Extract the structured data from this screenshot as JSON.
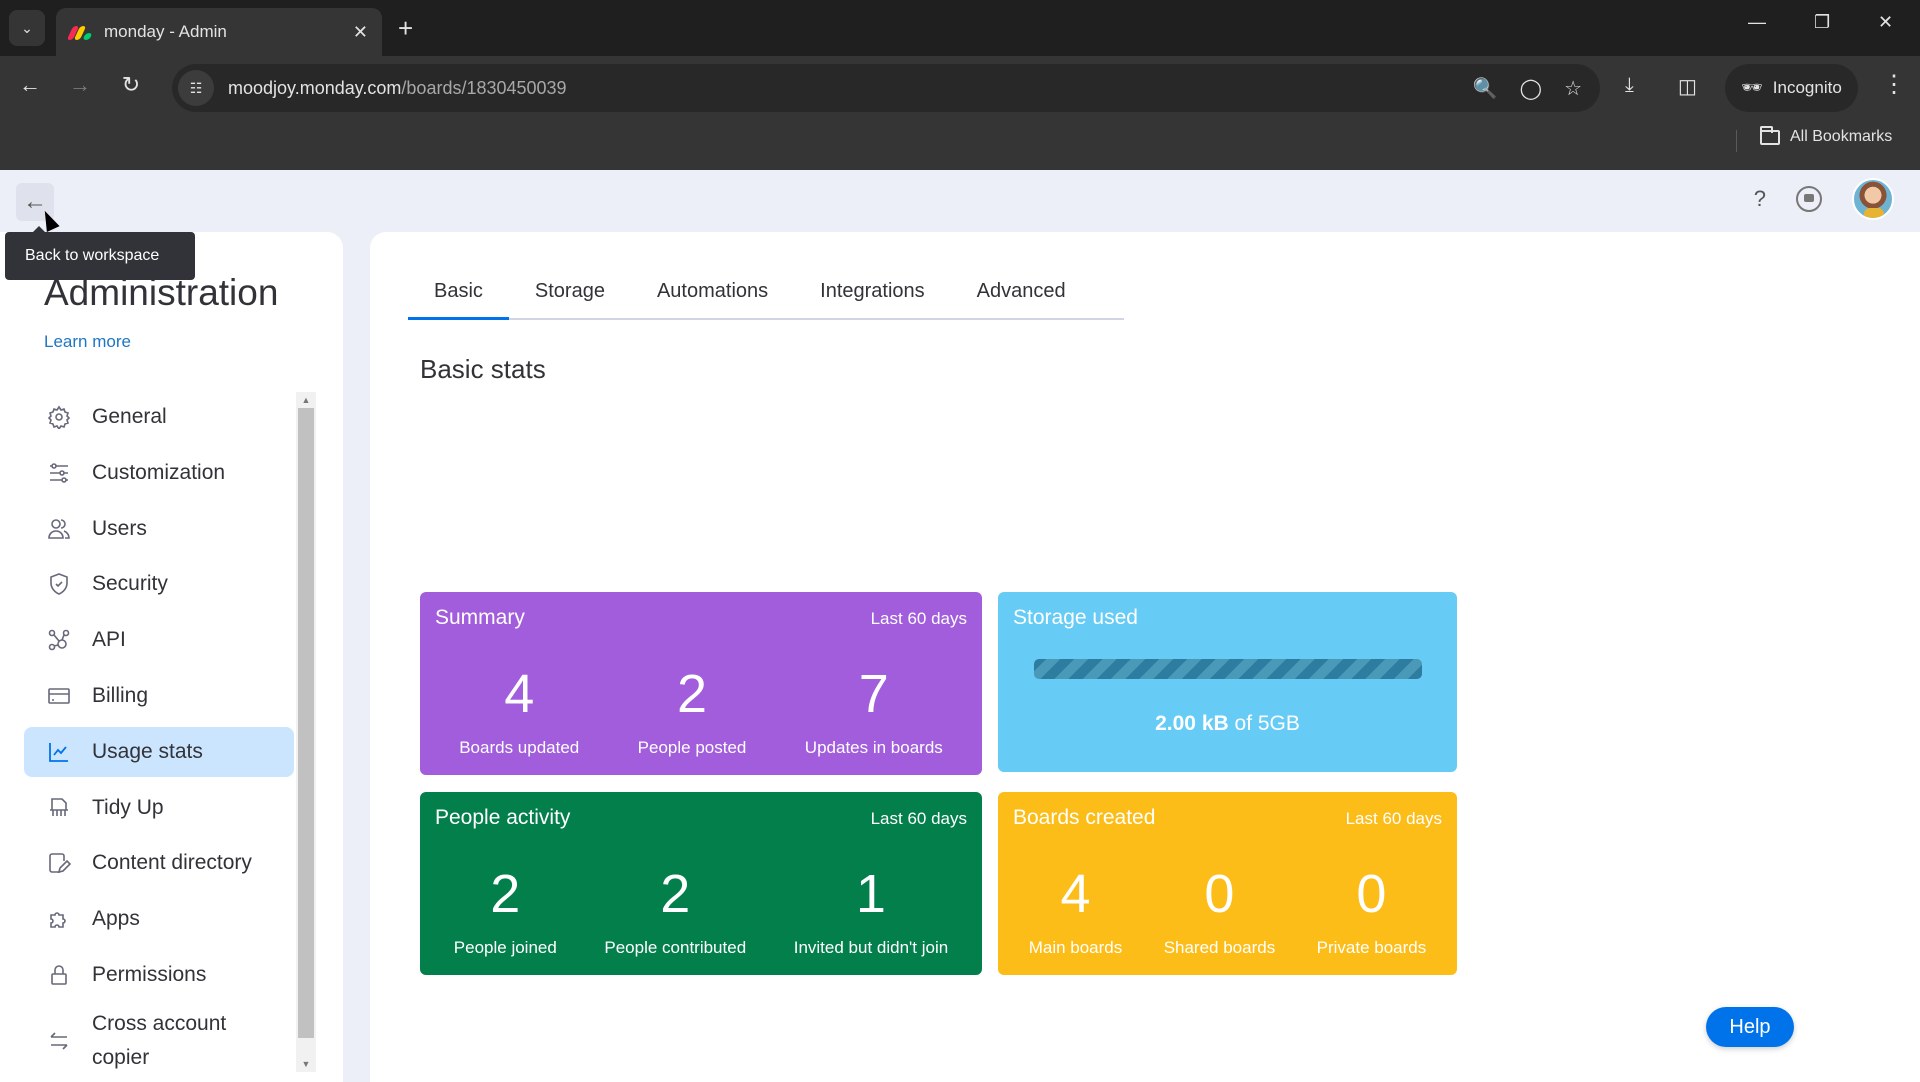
{
  "browser": {
    "tab_title": "monday - Admin",
    "url_host": "moodjoy.monday.com",
    "url_path": "/boards/1830450039",
    "incognito_label": "Incognito",
    "all_bookmarks_label": "All Bookmarks",
    "favicon_colors": [
      "#f62b54",
      "#ffcc00",
      "#00ca72"
    ]
  },
  "app": {
    "back_tooltip": "Back to workspace",
    "help_icon": "?",
    "help_button": "Help"
  },
  "sidebar": {
    "title": "Administration",
    "learn_more": "Learn more",
    "items": [
      {
        "label": "General",
        "icon": "gear-icon"
      },
      {
        "label": "Customization",
        "icon": "sliders-icon"
      },
      {
        "label": "Users",
        "icon": "users-icon"
      },
      {
        "label": "Security",
        "icon": "shield-icon"
      },
      {
        "label": "API",
        "icon": "api-icon"
      },
      {
        "label": "Billing",
        "icon": "credit-card-icon"
      },
      {
        "label": "Usage stats",
        "icon": "chart-icon",
        "active": true
      },
      {
        "label": "Tidy Up",
        "icon": "shredder-icon"
      },
      {
        "label": "Content directory",
        "icon": "content-directory-icon"
      },
      {
        "label": "Apps",
        "icon": "puzzle-icon"
      },
      {
        "label": "Permissions",
        "icon": "lock-icon"
      },
      {
        "label": "Cross account copier",
        "icon": "swap-icon"
      }
    ]
  },
  "main": {
    "tabs": [
      {
        "label": "Basic",
        "active": true
      },
      {
        "label": "Storage"
      },
      {
        "label": "Automations"
      },
      {
        "label": "Integrations"
      },
      {
        "label": "Advanced"
      }
    ],
    "section_title": "Basic stats",
    "cards": {
      "summary": {
        "title": "Summary",
        "period": "Last 60 days",
        "color": "#a25ddc",
        "stats": [
          {
            "value": "4",
            "label": "Boards updated"
          },
          {
            "value": "2",
            "label": "People posted"
          },
          {
            "value": "7",
            "label": "Updates in boards"
          }
        ]
      },
      "storage": {
        "title": "Storage used",
        "color": "#66ccf5",
        "used": "2.00 kB",
        "of_label": "of 5GB",
        "used_fraction": 0.0
      },
      "people": {
        "title": "People activity",
        "period": "Last 60 days",
        "color": "#037f4c",
        "stats": [
          {
            "value": "2",
            "label": "People joined"
          },
          {
            "value": "2",
            "label": "People contributed"
          },
          {
            "value": "1",
            "label": "Invited but didn't join"
          }
        ]
      },
      "boards": {
        "title": "Boards created",
        "period": "Last 60 days",
        "color": "#fdbd18",
        "stats": [
          {
            "value": "4",
            "label": "Main boards"
          },
          {
            "value": "0",
            "label": "Shared boards"
          },
          {
            "value": "0",
            "label": "Private boards"
          }
        ]
      }
    }
  }
}
